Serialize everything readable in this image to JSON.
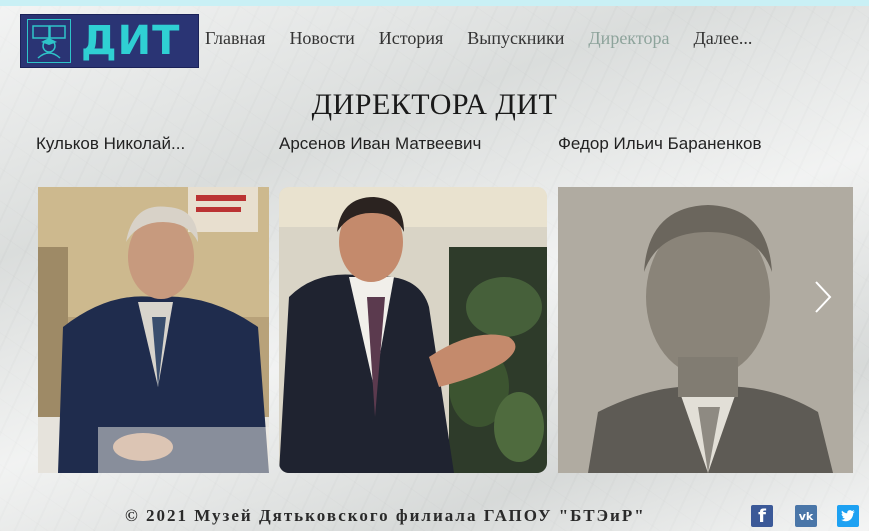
{
  "header": {
    "logo_text": "ДИТ",
    "nav": [
      "Главная",
      "Новости",
      "История",
      "Выпускники",
      "Директора",
      "Далее..."
    ],
    "active_nav": "Директора"
  },
  "main": {
    "title": "ДИРЕКТОРА ДИТ",
    "directors": [
      "Кульков Николай...",
      "Арсенов Иван Матвеевич",
      "Федор Ильич Бараненков"
    ]
  },
  "footer": {
    "copyright": "© 2021 Музей Дятьковского филиала ГАПОУ \"БТЭиР\"",
    "social": [
      {
        "icon": "facebook-icon",
        "glyph": "f",
        "color": "#3b5998"
      },
      {
        "icon": "vk-icon",
        "glyph": "vk",
        "color": "#4a76a8"
      },
      {
        "icon": "twitter-icon",
        "glyph": "t",
        "color": "#1da1f2"
      }
    ]
  }
}
